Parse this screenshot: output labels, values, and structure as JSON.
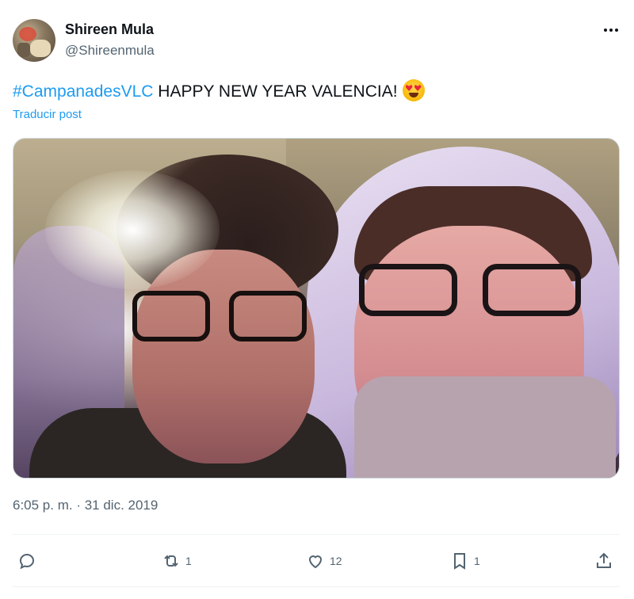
{
  "author": {
    "display_name": "Shireen Mula",
    "handle": "@Shireenmula"
  },
  "post": {
    "hashtag": "#CampanadesVLC",
    "text": " HAPPY NEW YEAR VALENCIA!",
    "emoji": "heart-eyes-emoji",
    "translate_label": "Traducir post",
    "timestamp": "6:05 p. m. · 31 dic. 2019"
  },
  "actions": {
    "replies": "",
    "reposts": "1",
    "likes": "12",
    "bookmarks": "1"
  },
  "colors": {
    "link": "#1d9bf0",
    "text": "#0f1419",
    "muted": "#536471"
  }
}
